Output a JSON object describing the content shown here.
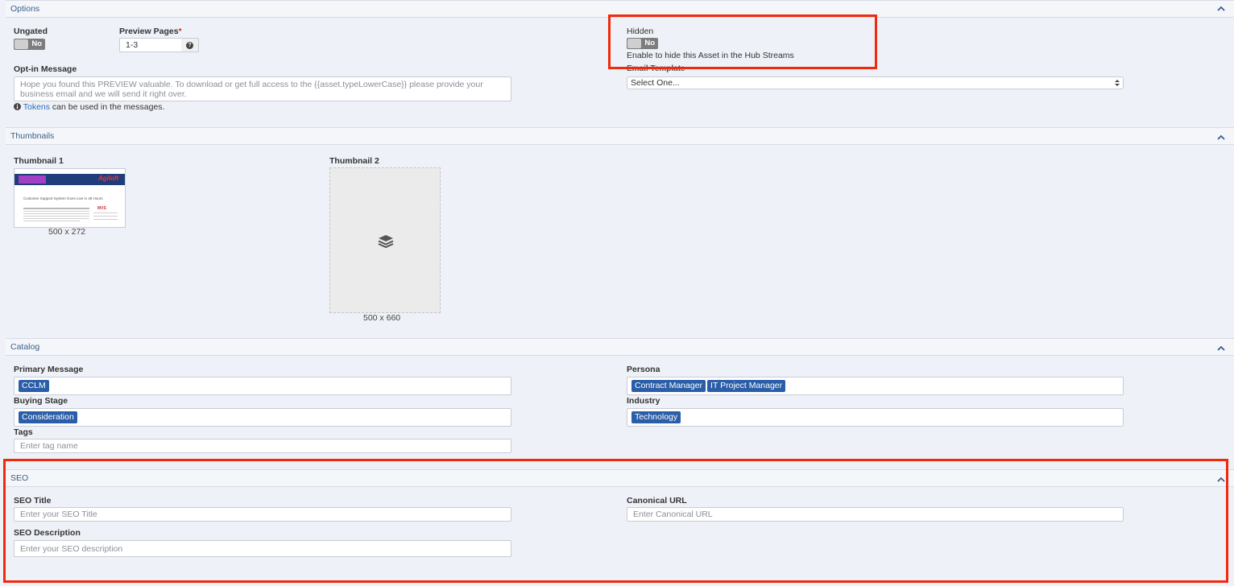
{
  "options": {
    "title": "Options",
    "ungated_label": "Ungated",
    "ungated_value": "No",
    "preview_pages_label": "Preview Pages",
    "preview_pages_required": "*",
    "preview_pages_value": "1-3",
    "optin_label": "Opt-in Message",
    "optin_placeholder": "Hope you found this PREVIEW valuable. To download or get full access to the {{asset.typeLowerCase}} please provide your business email and we will send it right over.",
    "tokens_link": "Tokens",
    "tokens_note": " can be used in the messages.",
    "hidden_label": "Hidden",
    "hidden_value": "No",
    "hidden_help": "Enable to hide this Asset in the Hub Streams",
    "email_template_label": "Email Template",
    "email_template_value": "Select One..."
  },
  "thumbnails": {
    "title": "Thumbnails",
    "thumb1_label": "Thumbnail 1",
    "thumb1_size": "500 x 272",
    "thumb1_preview": {
      "brand": "Agiloft",
      "heading": "Customer Support System Goes Live in 48 Hours",
      "partner": "MVS"
    },
    "thumb2_label": "Thumbnail 2",
    "thumb2_size": "500 x 660"
  },
  "catalog": {
    "title": "Catalog",
    "primary_message_label": "Primary Message",
    "primary_message_tags": [
      "CCLM"
    ],
    "buying_stage_label": "Buying Stage",
    "buying_stage_tags": [
      "Consideration"
    ],
    "tags_label": "Tags",
    "tags_placeholder": "Enter tag name",
    "persona_label": "Persona",
    "persona_tags": [
      "Contract Manager",
      "IT Project Manager"
    ],
    "industry_label": "Industry",
    "industry_tags": [
      "Technology"
    ]
  },
  "seo": {
    "title": "SEO",
    "seo_title_label": "SEO Title",
    "seo_title_placeholder": "Enter your SEO Title",
    "seo_description_label": "SEO Description",
    "seo_description_placeholder": "Enter your SEO description",
    "canonical_label": "Canonical URL",
    "canonical_placeholder": "Enter Canonical URL"
  },
  "colors": {
    "tag_blue": "#2a5ea8",
    "highlight_red": "#f02a0c",
    "header_text": "#3a5f8a",
    "link": "#2a6db5"
  }
}
